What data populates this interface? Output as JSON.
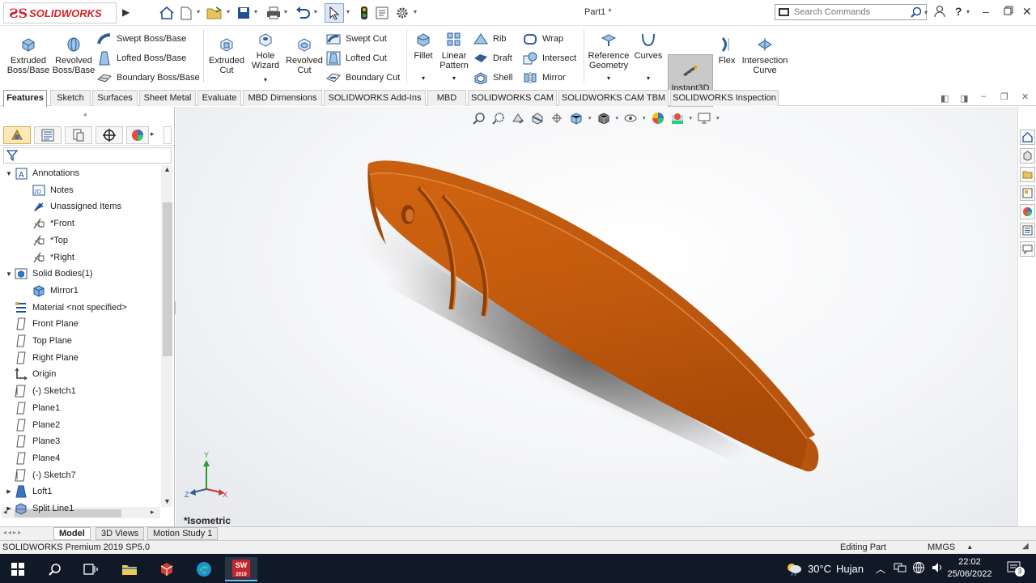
{
  "app": {
    "logo_text": "SOLIDWORKS",
    "document_title": "Part1 *"
  },
  "search": {
    "placeholder": "Search Commands"
  },
  "command_manager": {
    "extruded_boss": "Extruded Boss/Base",
    "revolved_boss": "Revolved Boss/Base",
    "swept_boss": "Swept Boss/Base",
    "lofted_boss": "Lofted Boss/Base",
    "boundary_boss": "Boundary Boss/Base",
    "extruded_cut": "Extruded Cut",
    "hole_wizard": "Hole Wizard",
    "revolved_cut": "Revolved Cut",
    "swept_cut": "Swept Cut",
    "lofted_cut": "Lofted Cut",
    "boundary_cut": "Boundary Cut",
    "fillet": "Fillet",
    "linear_pattern": "Linear Pattern",
    "rib": "Rib",
    "draft": "Draft",
    "shell": "Shell",
    "wrap": "Wrap",
    "intersect": "Intersect",
    "mirror": "Mirror",
    "reference_geometry": "Reference Geometry",
    "curves": "Curves",
    "instant3d": "Instant3D",
    "flex": "Flex",
    "intersection_curve": "Intersection Curve"
  },
  "tabs": [
    "Features",
    "Sketch",
    "Surfaces",
    "Sheet Metal",
    "Evaluate",
    "MBD Dimensions",
    "SOLIDWORKS Add-Ins",
    "MBD",
    "SOLIDWORKS CAM",
    "SOLIDWORKS CAM TBM",
    "SOLIDWORKS Inspection"
  ],
  "tree": [
    "Annotations",
    "Notes",
    "Unassigned Items",
    "*Front",
    "*Top",
    "*Right",
    "Solid Bodies(1)",
    "Mirror1",
    "Material <not specified>",
    "Front Plane",
    "Top Plane",
    "Right Plane",
    "Origin",
    "(-) Sketch1",
    "Plane1",
    "Plane2",
    "Plane3",
    "Plane4",
    "(-) Sketch7",
    "Loft1",
    "Split Line1"
  ],
  "viewport": {
    "view_label": "*Isometric",
    "axis_labels": {
      "y": "Y",
      "x": "X",
      "z": "Z"
    },
    "part_color": "#c35a10"
  },
  "bottom_tabs": [
    "Model",
    "3D Views",
    "Motion Study 1"
  ],
  "status": {
    "product": "SOLIDWORKS Premium 2019 SP5.0",
    "mode": "Editing Part",
    "units": "MMGS"
  },
  "taskbar": {
    "temperature": "30°C",
    "weather": "Hujan",
    "time": "22:02",
    "date": "25/06/2022",
    "sw_badge": "2019",
    "sw_letters": "SW",
    "notification_count": "3"
  }
}
